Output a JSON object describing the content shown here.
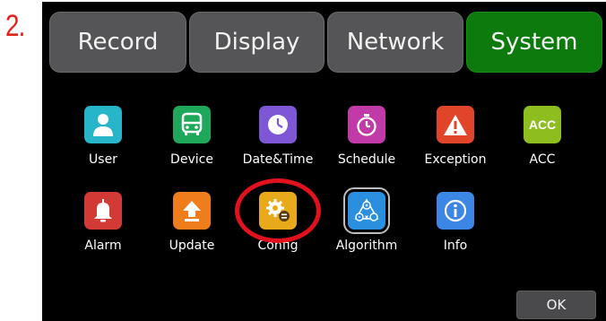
{
  "step_label": "2.",
  "tabs": [
    {
      "label": "Record"
    },
    {
      "label": "Display"
    },
    {
      "label": "Network"
    },
    {
      "label": "System",
      "active": true
    }
  ],
  "items": [
    {
      "label": "User",
      "icon": "user-icon",
      "color": "#26b5c9"
    },
    {
      "label": "Device",
      "icon": "bus-icon",
      "color": "#1fa85a"
    },
    {
      "label": "Date&Time",
      "icon": "clock-icon",
      "color": "#7e57d6"
    },
    {
      "label": "Schedule",
      "icon": "timer-icon",
      "color": "#c03aa8"
    },
    {
      "label": "Exception",
      "icon": "warning-icon",
      "color": "#e0452a"
    },
    {
      "label": "ACC",
      "icon": "acc-icon",
      "icon_text": "ACC",
      "color": "#8dbd1e"
    },
    {
      "label": "Alarm",
      "icon": "bell-icon",
      "color": "#d23a36"
    },
    {
      "label": "Update",
      "icon": "upload-icon",
      "color": "#ef7d1c"
    },
    {
      "label": "Config",
      "icon": "gear-icon",
      "color": "#e8a91a"
    },
    {
      "label": "Algorithm",
      "icon": "algorithm-icon",
      "color": "#2b8fe0",
      "selected": true
    },
    {
      "label": "Info",
      "icon": "info-icon",
      "color": "#3c86e6"
    }
  ],
  "ok_label": "OK",
  "highlight_color": "#e2121c"
}
